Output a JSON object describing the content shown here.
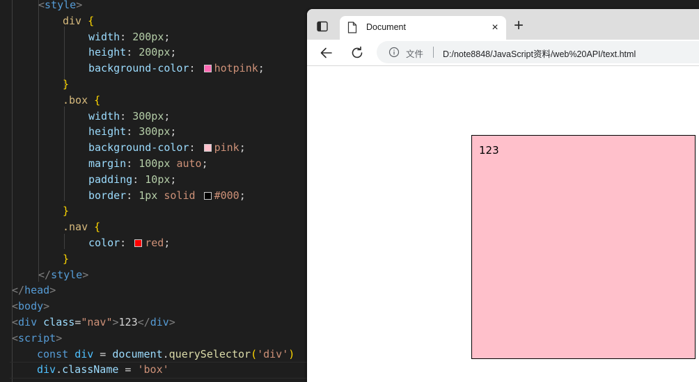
{
  "editor": {
    "line1": {
      "lt": "<",
      "tag": "style",
      "gt": ">"
    },
    "line2": {
      "selector": "div",
      "brace": "{"
    },
    "line3": {
      "prop": "width",
      "colon": ": ",
      "value": "200px",
      "semi": ";"
    },
    "line4": {
      "prop": "height",
      "colon": ": ",
      "value": "200px",
      "semi": ";"
    },
    "line5": {
      "prop": "background-color",
      "colon": ": ",
      "value": "hotpink",
      "semi": ";",
      "swatch": "#ff69b4"
    },
    "line6": {
      "brace": "}"
    },
    "line7": {
      "selector": ".box",
      "brace": "{"
    },
    "line8": {
      "prop": "width",
      "colon": ": ",
      "value": "300px",
      "semi": ";"
    },
    "line9": {
      "prop": "height",
      "colon": ": ",
      "value": "300px",
      "semi": ";"
    },
    "line10": {
      "prop": "background-color",
      "colon": ": ",
      "value": "pink",
      "semi": ";",
      "swatch": "#ffc0cb"
    },
    "line11": {
      "prop": "margin",
      "colon": ": ",
      "num": "100px",
      "value": "auto",
      "semi": ";"
    },
    "line12": {
      "prop": "padding",
      "colon": ": ",
      "value": "10px",
      "semi": ";"
    },
    "line13": {
      "prop": "border",
      "colon": ": ",
      "num": "1px",
      "value": "solid",
      "value2": "#000",
      "semi": ";",
      "swatch": "#000000"
    },
    "line14": {
      "brace": "}"
    },
    "line15": {
      "selector": ".nav",
      "brace": "{"
    },
    "line16": {
      "prop": "color",
      "colon": ": ",
      "value": "red",
      "semi": ";",
      "swatch": "#ff0000"
    },
    "line17": {
      "brace": "}"
    },
    "line18": {
      "lt": "</",
      "tag": "style",
      "gt": ">"
    },
    "line19": {
      "lt": "</",
      "tag": "head",
      "gt": ">"
    },
    "line20": {
      "lt": "<",
      "tag": "body",
      "gt": ">"
    },
    "line21": {
      "lt": "<",
      "tag": "div",
      "attr": "class",
      "eq": "=",
      "attrval": "\"nav\"",
      "gt": ">",
      "text": "123",
      "lt2": "</",
      "tag2": "div",
      "gt2": ">"
    },
    "line22": {
      "lt": "<",
      "tag": "script",
      "gt": ">"
    },
    "line23": {
      "kw": "const",
      "var": "div",
      "eq": " = ",
      "obj": "document",
      "dot": ".",
      "fn": "querySelector",
      "open": "(",
      "str": "'div'",
      "close": ")"
    },
    "line24": {
      "obj": "div",
      "dot": ".",
      "prop": "className",
      "eq": " = ",
      "str": "'box'"
    }
  },
  "browser": {
    "tab_title": "Document",
    "tab_close": "×",
    "new_tab": "+",
    "site_label": "文件",
    "url": "D:/note8848/JavaScript资料/web%20API/text.html",
    "page_text": "123",
    "box_color": "#ffc0cb",
    "border_color": "#000000"
  }
}
